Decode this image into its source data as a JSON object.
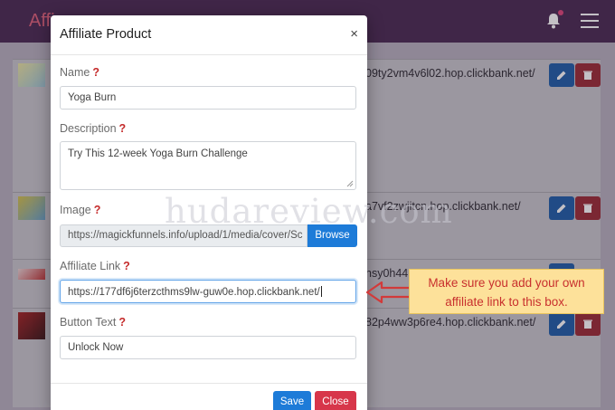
{
  "background": {
    "brand_text": "Affi",
    "rows": [
      {
        "url": "09ty2vm4v6l02.hop.clickbank.net/"
      },
      {
        "url": "a7vf2zwjitcn.hop.clickbank.net/"
      },
      {
        "url": "hsy0h44"
      },
      {
        "url": "82p4ww3p6re4.hop.clickbank.net/"
      }
    ]
  },
  "modal": {
    "title": "Affiliate Product",
    "close_glyph": "×",
    "name": {
      "label": "Name",
      "help": "?",
      "value": "Yoga Burn"
    },
    "description": {
      "label": "Description",
      "help": "?",
      "value": "Try This 12-week Yoga Burn Challenge"
    },
    "image": {
      "label": "Image",
      "help": "?",
      "value": "https://magickfunnels.info/upload/1/media/cover/Sc",
      "browse_label": "Browse"
    },
    "affiliate_link": {
      "label": "Affiliate Link",
      "help": "?",
      "value": "https://177df6j6terzcthms9lw-guw0e.hop.clickbank.net/"
    },
    "button_text": {
      "label": "Button Text",
      "help": "?",
      "value": "Unlock Now"
    },
    "save_label": "Save",
    "close_label": "Close"
  },
  "watermark": "hudareview.com",
  "annotation": {
    "line1": "Make sure you add your own",
    "line2": "affiliate link to this box.",
    "arrow_color": "#d23a3a"
  },
  "colors": {
    "primary": "#1d7bd8",
    "danger": "#d7364a",
    "topbar": "#4a2a52"
  }
}
